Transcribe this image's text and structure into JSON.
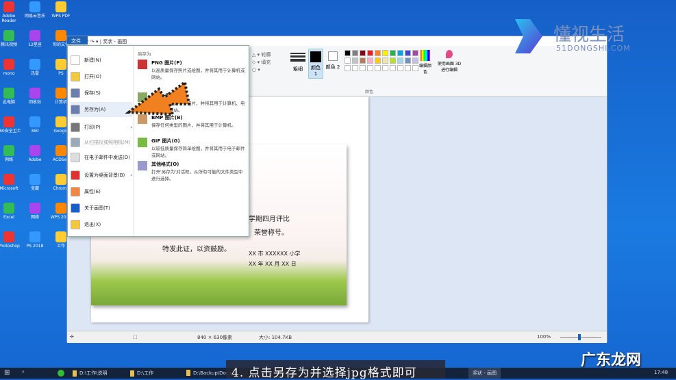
{
  "desktop": {
    "icons": [
      "Adobe Reader",
      "网易云音乐",
      "WPS PDF",
      "腾讯视频",
      "12星座",
      "你的文件",
      "mono",
      "迅雷",
      "PS",
      "此电脑",
      "回收站",
      "计算机",
      "360安全卫士",
      "360",
      "Google",
      "网络",
      "Adobe",
      "ACDSee",
      "Microsoft",
      "宝藏",
      "Chrome",
      "Excel",
      "网络",
      "WPS 2019",
      "Photoshop",
      "PS 2018",
      "工作"
    ]
  },
  "paint": {
    "title": "奖状 - 画图",
    "file_tab": "文件",
    "menu": {
      "items": [
        {
          "label": "新建(N)"
        },
        {
          "label": "打开(O)"
        },
        {
          "label": "保存(S)"
        },
        {
          "label": "另存为(A)"
        },
        {
          "label": "打印(P)"
        },
        {
          "label": "从扫描仪或照相机(M)",
          "disabled": true
        },
        {
          "label": "在电子邮件中发送(D)"
        },
        {
          "label": "设置为桌面背景(B)"
        },
        {
          "label": "属性(E)"
        },
        {
          "label": "关于画图(T)"
        },
        {
          "label": "退出(X)"
        }
      ],
      "saveas_header": "另存为",
      "formats": [
        {
          "name": "PNG 图片(P)",
          "desc": "以高质量保存照片或绘图，并将其用于计算机或网站。"
        },
        {
          "name": "JPEG 图片(J)",
          "desc": "以良好的质量保存照片，并将其用于计算机、电子邮件或网站。"
        },
        {
          "name": "BMP 图片(B)",
          "desc": "保存任何类型的图片，并将其用于计算机。"
        },
        {
          "name": "GIF 图片(G)",
          "desc": "以较低质量保存简单绘图，并将其用于电子邮件或网站。"
        },
        {
          "name": "其他格式(O)",
          "desc": "打开'另存为'对话框，从所有可能的文件类型中进行选择。"
        }
      ]
    },
    "ribbon": {
      "outline": "轮廓",
      "fill": "填充",
      "thickness": "粗细",
      "color1": "颜色 1",
      "color2": "颜色 2",
      "edit_colors": "编辑颜色",
      "paint3d": "使用画图 3D 进行编辑",
      "colors_group": "颜色",
      "palette": [
        "#000000",
        "#7f7f7f",
        "#880015",
        "#ed1c24",
        "#ff7f27",
        "#fff200",
        "#22b14c",
        "#00a2e8",
        "#3f48cc",
        "#a349a4",
        "#ffffff",
        "#c3c3c3",
        "#b97a57",
        "#ffaec9",
        "#ffc90e",
        "#efe4b0",
        "#b5e61d",
        "#99d9ea",
        "#7092be",
        "#c8bfe7"
      ]
    },
    "certificate": {
      "line1": "学期四月评比",
      "line2": "荣誉称号。",
      "line3": "特发此证，以资鼓励。",
      "school": "XX 市 XXXXXX 小学",
      "date": "XX 年 XX 月 XX 日"
    },
    "status": {
      "dimensions": "840 × 630像素",
      "size": "大小: 104.7KB",
      "zoom": "100%"
    }
  },
  "taskbar": {
    "items": [
      "D:\\工作\\说明",
      "D:\\工作",
      "D:\\Backup\\Docu...",
      "奖状 - 画图"
    ],
    "time": "17:48"
  },
  "subtitle": "4. 点击另存为并选择jpg格式即可",
  "watermarks": {
    "logo_cn": "懂视生活",
    "logo_en": "51DONGSHI.COM",
    "corner": "广东龙网"
  }
}
